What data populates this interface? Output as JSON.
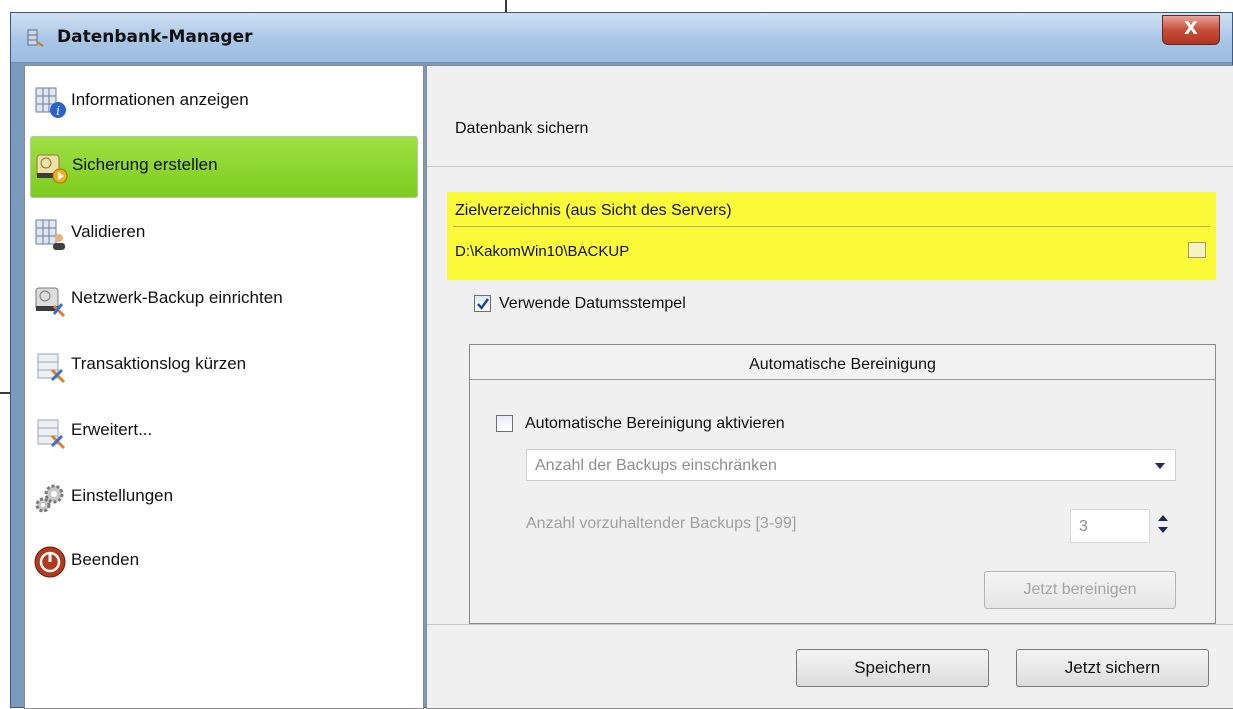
{
  "window": {
    "title": "Datenbank-Manager",
    "close_label": "X"
  },
  "sidebar": {
    "items": [
      {
        "label": "Informationen anzeigen",
        "icon": "database-info-icon",
        "selected": false
      },
      {
        "label": "Sicherung erstellen",
        "icon": "backup-create-icon",
        "selected": true
      },
      {
        "label": "Validieren",
        "icon": "database-user-icon",
        "selected": false
      },
      {
        "label": "Netzwerk-Backup einrichten",
        "icon": "network-backup-icon",
        "selected": false
      },
      {
        "label": "Transaktionslog kürzen",
        "icon": "database-tools-icon",
        "selected": false
      },
      {
        "label": "Erweitert...",
        "icon": "database-tools-icon",
        "selected": false
      },
      {
        "label": "Einstellungen",
        "icon": "gears-icon",
        "selected": false
      },
      {
        "label": "Beenden",
        "icon": "power-icon",
        "selected": false
      }
    ]
  },
  "main": {
    "section_title": "Datenbank sichern",
    "target": {
      "label": "Zielverzeichnis (aus Sicht des Servers)",
      "path": "D:\\KakomWin10\\BACKUP"
    },
    "use_timestamp": {
      "label": "Verwende Datumsstempel",
      "checked": true
    },
    "cleanup": {
      "title": "Automatische Bereinigung",
      "enable_label": "Automatische Bereinigung aktivieren",
      "enabled": false,
      "mode_value": "Anzahl der Backups einschränken",
      "count_label": "Anzahl vorzuhaltender Backups [3-99]",
      "count_value": "3",
      "clean_now_label": "Jetzt bereinigen"
    },
    "buttons": {
      "save_label": "Speichern",
      "backup_now_label": "Jetzt sichern"
    }
  },
  "colors": {
    "selection_green": "#8ed634",
    "highlight_yellow": "#fbfb3a",
    "close_red": "#c84d3a"
  }
}
